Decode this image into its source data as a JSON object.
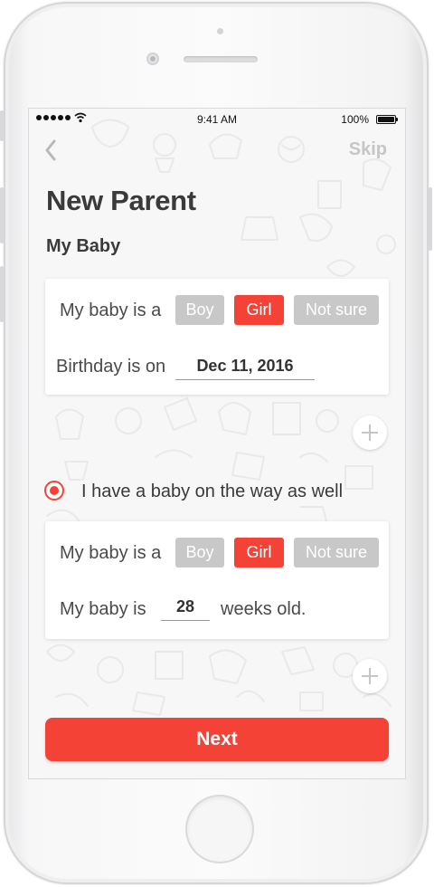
{
  "status_bar": {
    "time": "9:41 AM",
    "battery": "100%"
  },
  "nav": {
    "back_icon": "chevron-left-icon",
    "skip_label": "Skip"
  },
  "header": {
    "title": "New Parent",
    "subtitle": "My Baby"
  },
  "baby_card": {
    "gender_label": "My baby is a",
    "gender_options": [
      "Boy",
      "Girl",
      "Not sure"
    ],
    "gender_selected": "Girl",
    "birthday_label": "Birthday is on",
    "birthday_value": "Dec 11, 2016"
  },
  "expecting": {
    "radio_label": "I have a baby on  the way as well",
    "radio_selected": true
  },
  "expecting_card": {
    "gender_label": "My baby is a",
    "gender_options": [
      "Boy",
      "Girl",
      "Not sure"
    ],
    "gender_selected": "Girl",
    "weeks_prefix": "My baby is",
    "weeks_value": "28",
    "weeks_suffix": "weeks old."
  },
  "footer": {
    "next_label": "Next"
  },
  "colors": {
    "accent": "#f44336",
    "inactive": "#c8c8c8",
    "text": "#3a3a3a"
  }
}
